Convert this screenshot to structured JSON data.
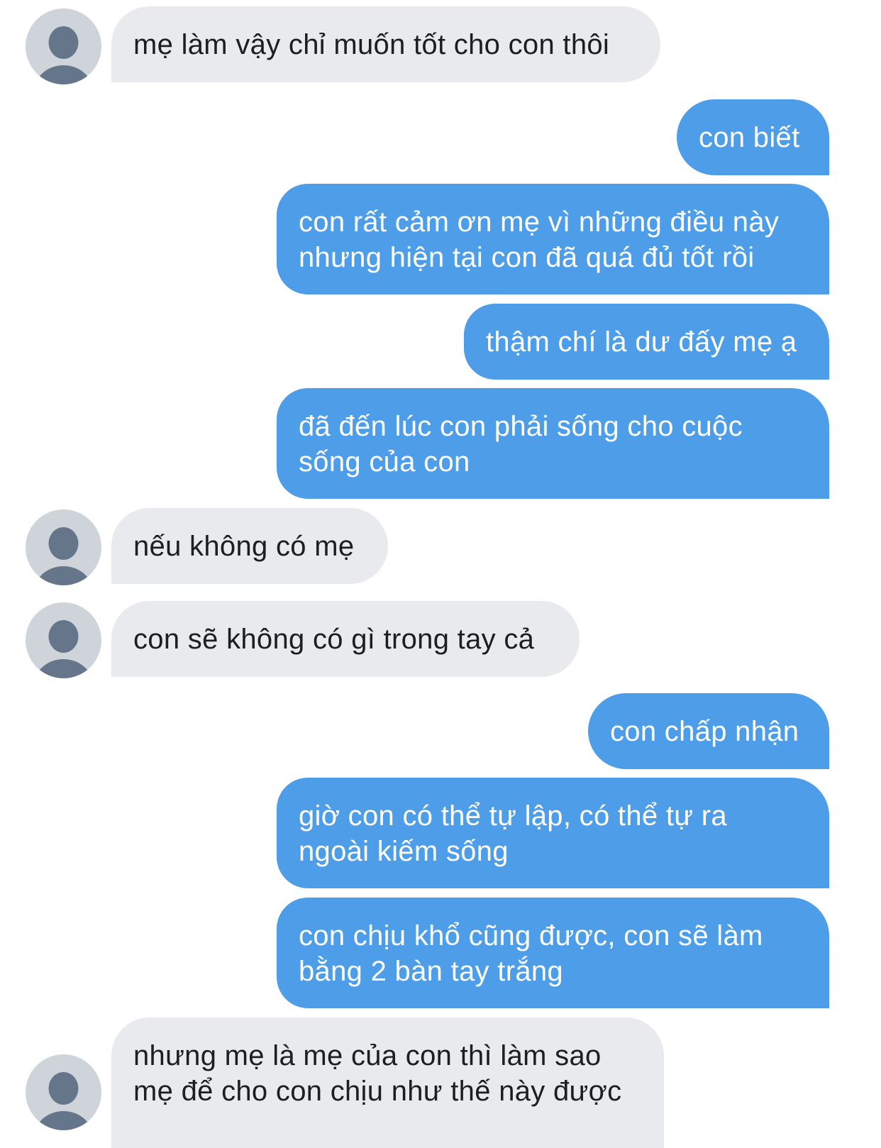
{
  "conversation": {
    "messages": [
      {
        "sender": "mother",
        "lines": [
          "mẹ làm vậy chỉ muốn tốt cho con thôi"
        ]
      },
      {
        "sender": "me",
        "lines": [
          "con biết"
        ]
      },
      {
        "sender": "me",
        "lines": [
          "con rất cảm ơn mẹ vì những điều này",
          "nhưng hiện tại con đã quá đủ tốt rồi"
        ]
      },
      {
        "sender": "me",
        "lines": [
          "thậm chí là dư đấy mẹ ạ"
        ]
      },
      {
        "sender": "me",
        "lines": [
          "đã đến lúc con phải sống cho cuộc",
          "sống của con"
        ]
      },
      {
        "sender": "mother",
        "lines": [
          "nếu không có mẹ"
        ]
      },
      {
        "sender": "mother",
        "lines": [
          "con sẽ không có gì trong tay cả"
        ]
      },
      {
        "sender": "me",
        "lines": [
          "con chấp nhận"
        ]
      },
      {
        "sender": "me",
        "lines": [
          "giờ con có thể tự lập, có thể tự ra",
          "ngoài kiếm sống"
        ]
      },
      {
        "sender": "me",
        "lines": [
          "con chịu khổ cũng được, con sẽ làm",
          "bằng 2 bàn tay trắng"
        ]
      },
      {
        "sender": "mother",
        "lines": [
          "nhưng mẹ là mẹ của con thì làm sao",
          "mẹ để cho con chịu như thế này được"
        ]
      }
    ]
  },
  "colors": {
    "incoming_bubble": "#e9eaed",
    "outgoing_bubble": "#4d9de9",
    "avatar_bg": "#cfd4da",
    "avatar_figure": "#66768a"
  },
  "icons": {
    "avatar": "default-user-silhouette-icon"
  }
}
